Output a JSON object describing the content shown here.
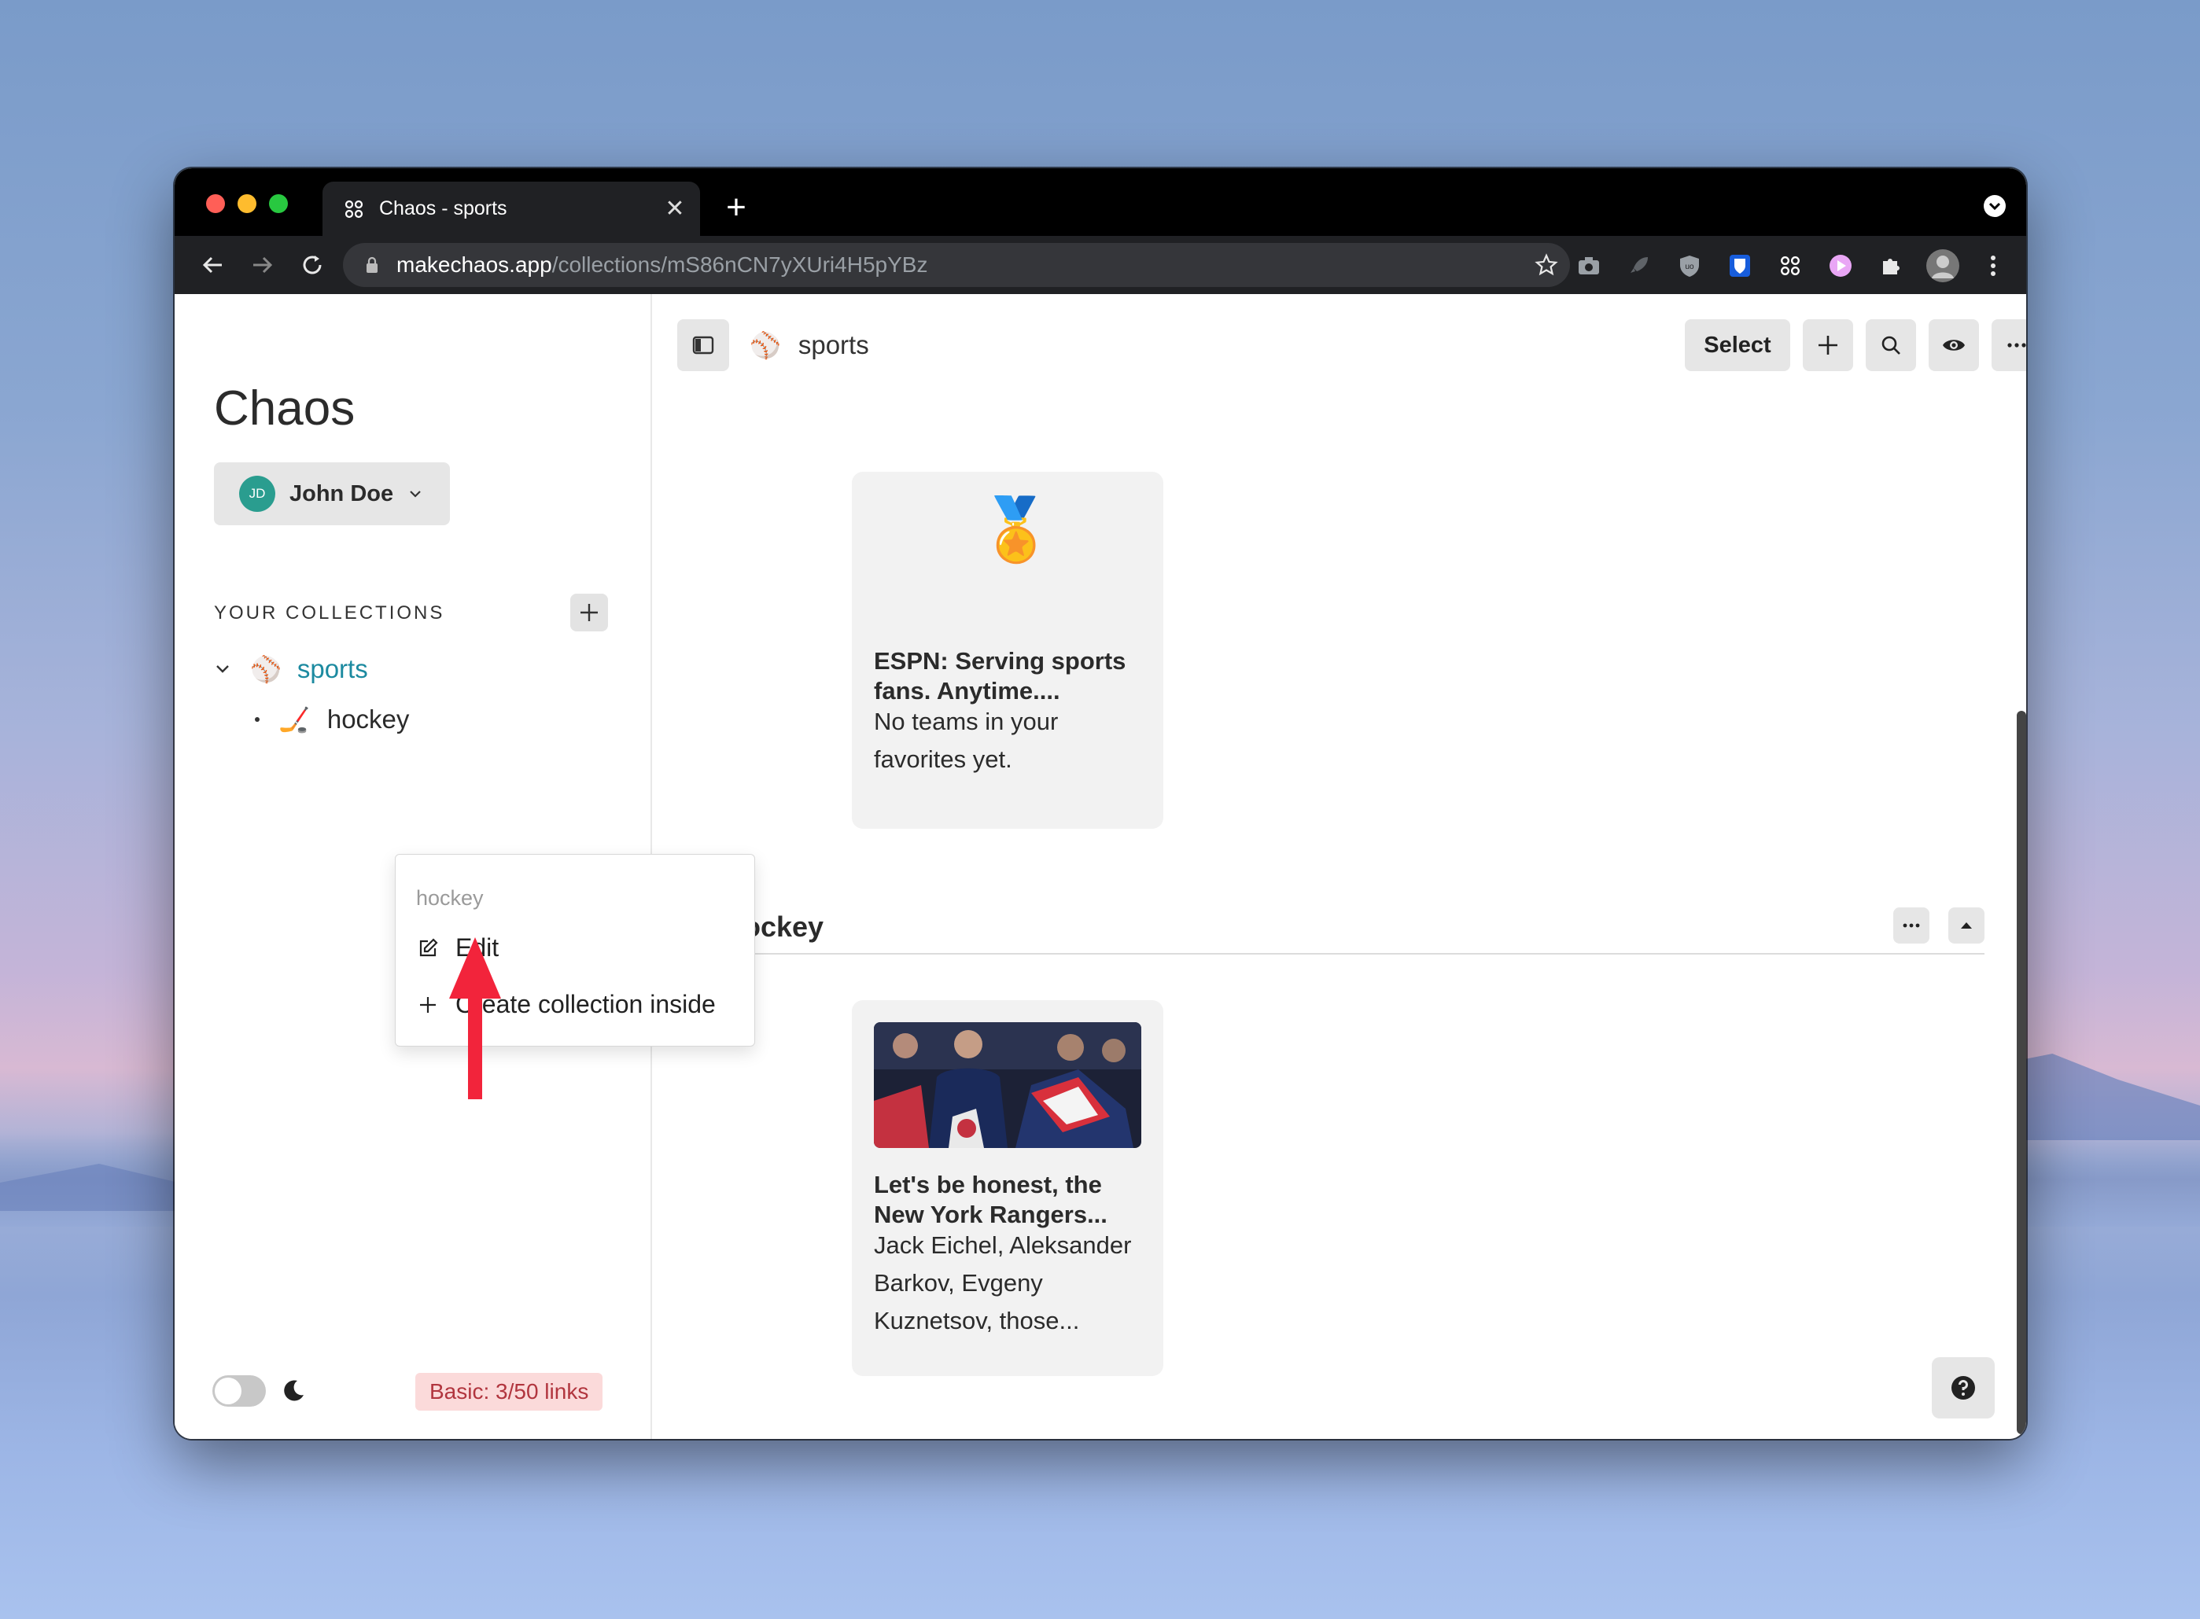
{
  "browser": {
    "tab_title": "Chaos - sports",
    "url_host": "makechaos.app",
    "url_path": "/collections/mS86nCN7yXUri4H5pYBz",
    "tab_close": "✕",
    "new_tab": "+"
  },
  "sidebar": {
    "app_title": "Chaos",
    "user": {
      "initials": "JD",
      "name": "John Doe"
    },
    "collections_label": "YOUR COLLECTIONS",
    "collections": [
      {
        "emoji": "⚾",
        "label": "sports",
        "expanded": true,
        "active": true
      },
      {
        "emoji": "🏒",
        "label": "hockey",
        "child": true
      }
    ],
    "plan_badge": "Basic: 3/50 links"
  },
  "main": {
    "breadcrumb_emoji": "⚾",
    "breadcrumb": "sports",
    "select_label": "Select",
    "cards": [
      {
        "emoji": "🏅",
        "title": "ESPN: Serving sports fans. Anytime....",
        "desc": "No teams in your favorites yet."
      },
      {
        "title": "Let's be honest, the New York Rangers...",
        "desc": "Jack Eichel, Aleksander Barkov, Evgeny Kuznetsov, those..."
      }
    ],
    "section": {
      "emoji": "🏒",
      "name": "hockey"
    }
  },
  "context_menu": {
    "header": "hockey",
    "items": [
      {
        "icon": "edit-icon",
        "label": "Edit"
      },
      {
        "icon": "plus-icon",
        "label": "Create collection inside"
      }
    ]
  },
  "colors": {
    "accent_teal": "#1c8aa0",
    "plan_badge_bg": "#fbdada",
    "plan_badge_text": "#b1353e",
    "annotation_arrow": "#f2243b"
  }
}
